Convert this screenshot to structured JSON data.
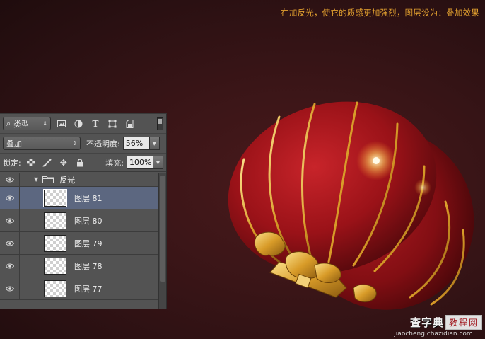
{
  "caption": "在加反光，使它的质感更加强烈，图层设为：叠加效果",
  "panel": {
    "kind_filter": "类型",
    "filter_icons": [
      "image-filter-icon",
      "adjustment-filter-icon",
      "type-filter-icon",
      "shape-filter-icon",
      "smart-object-filter-icon"
    ],
    "blend_mode": "叠加",
    "opacity_label": "不透明度:",
    "opacity_value": "56%",
    "lock_label": "锁定:",
    "fill_label": "填充:",
    "fill_value": "100%",
    "group": {
      "name": "反光"
    },
    "layers": [
      {
        "name": "图层 81",
        "selected": true
      },
      {
        "name": "图层 80",
        "selected": false
      },
      {
        "name": "图层 79",
        "selected": false
      },
      {
        "name": "图层 78",
        "selected": false
      },
      {
        "name": "图层 77",
        "selected": false
      }
    ]
  },
  "watermark": {
    "brand": "查字典",
    "tag": "教程网",
    "url": "jiaocheng.chazidian.com"
  },
  "colors": {
    "background": "#3a1517",
    "caption": "#e3a12f",
    "panel": "#535353",
    "selected_row": "#5c6780",
    "lantern_red": "#a8141a",
    "lantern_gold": "#e8b63a"
  }
}
